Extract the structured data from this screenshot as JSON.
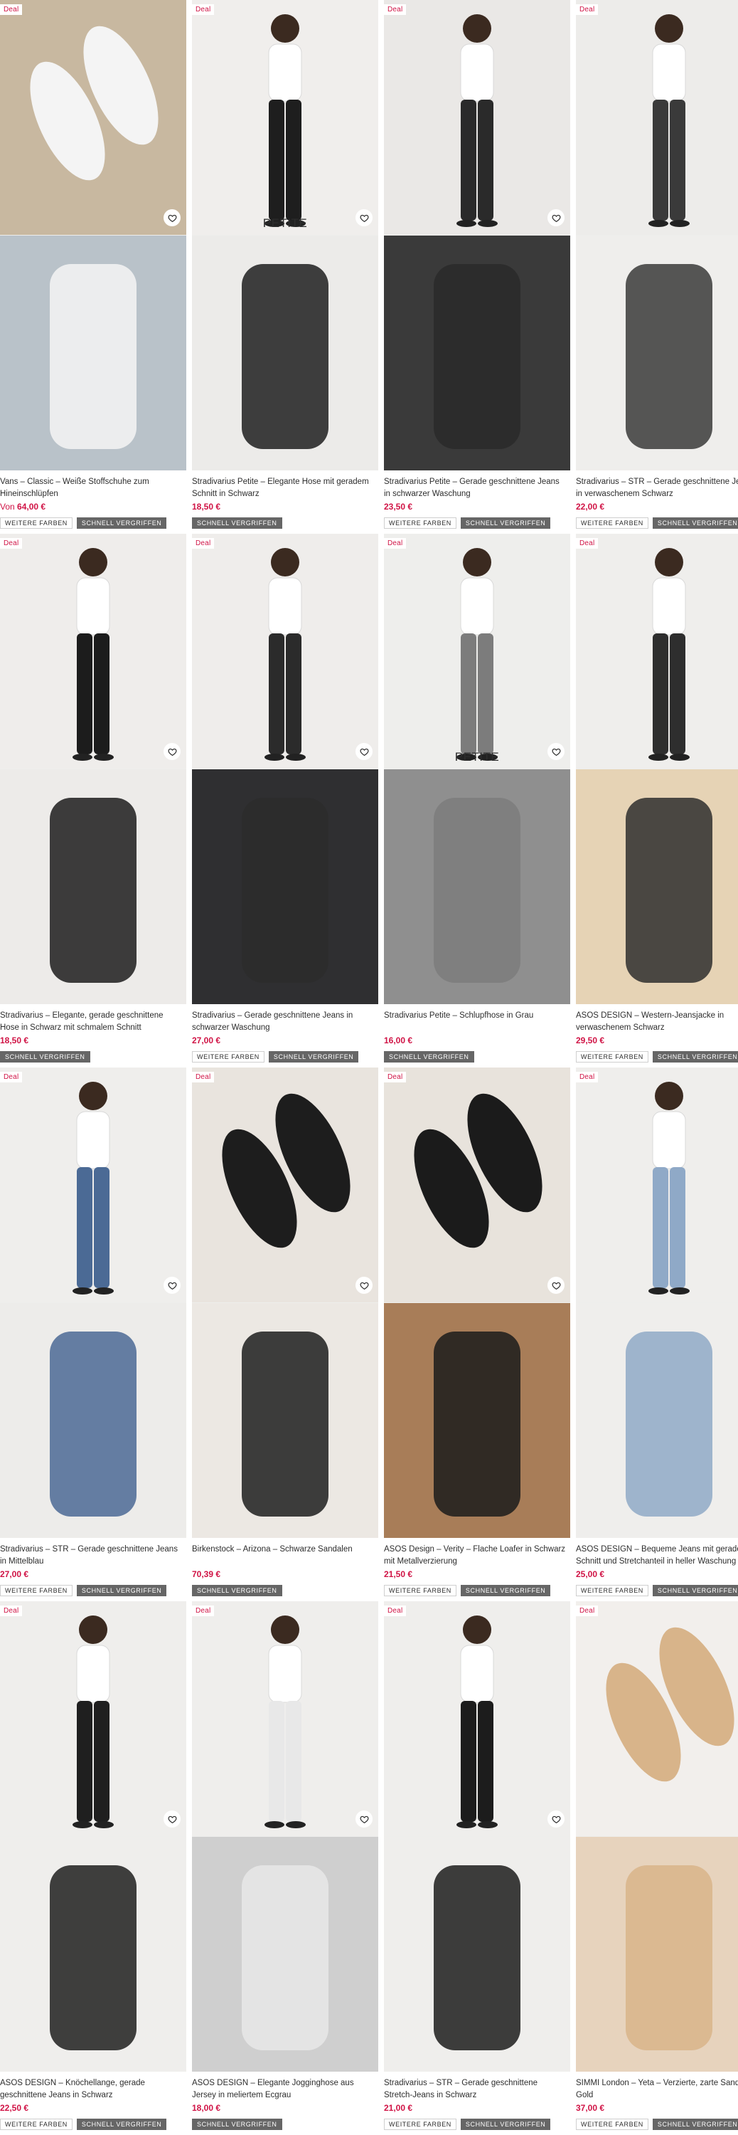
{
  "deal_label": "Deal",
  "badges": {
    "more_colors": "WEITERE FARBEN",
    "selling_fast": "SCHNELL VERGRIFFEN"
  },
  "products": [
    {
      "title": "Vans – Classic – Weiße Stoffschuhe zum Hineinschlüpfen",
      "price_prefix": "Von",
      "price": "64,00 €",
      "deal": true,
      "more_colors": true,
      "selling_fast": true,
      "petite": false,
      "img_a": "#c8b8a0",
      "img_b": "#b9c2c9"
    },
    {
      "title": "Stradivarius Petite – Elegante Hose mit geradem Schnitt in Schwarz",
      "price_prefix": "",
      "price": "18,50 €",
      "deal": true,
      "more_colors": false,
      "selling_fast": true,
      "petite": true,
      "img_a": "#f0eeec",
      "img_b": "#ecebe9"
    },
    {
      "title": "Stradivarius Petite – Gerade geschnittene Jeans in schwarzer Waschung",
      "price_prefix": "",
      "price": "23,50 €",
      "deal": true,
      "more_colors": true,
      "selling_fast": true,
      "petite": false,
      "img_a": "#eae8e6",
      "img_b": "#3a3a3a"
    },
    {
      "title": "Stradivarius – STR – Gerade geschnittene Jeans in verwaschenem Schwarz",
      "price_prefix": "",
      "price": "22,00 €",
      "deal": true,
      "more_colors": true,
      "selling_fast": true,
      "petite": false,
      "img_a": "#edecea",
      "img_b": "#efeeec"
    },
    {
      "title": "Stradivarius – Elegante, gerade geschnittene Hose in Schwarz mit schmalem Schnitt",
      "price_prefix": "",
      "price": "18,50 €",
      "deal": true,
      "more_colors": false,
      "selling_fast": true,
      "petite": false,
      "img_a": "#efedeb",
      "img_b": "#edebe9"
    },
    {
      "title": "Stradivarius – Gerade geschnittene Jeans in schwarzer Waschung",
      "price_prefix": "",
      "price": "27,00 €",
      "deal": true,
      "more_colors": true,
      "selling_fast": true,
      "petite": false,
      "img_a": "#efedeb",
      "img_b": "#2f2f31"
    },
    {
      "title": "Stradivarius Petite – Schlupfhose in Grau",
      "price_prefix": "",
      "price": "16,00 €",
      "deal": true,
      "more_colors": false,
      "selling_fast": true,
      "petite": true,
      "img_a": "#eeeeec",
      "img_b": "#8f8f8f"
    },
    {
      "title": "ASOS DESIGN – Western-Jeansjacke in verwaschenem Schwarz",
      "price_prefix": "",
      "price": "29,50 €",
      "deal": true,
      "more_colors": true,
      "selling_fast": true,
      "petite": false,
      "img_a": "#efeeec",
      "img_b": "#e6d3b5"
    },
    {
      "title": "Stradivarius – STR – Gerade geschnittene Jeans in Mittelblau",
      "price_prefix": "",
      "price": "27,00 €",
      "deal": true,
      "more_colors": true,
      "selling_fast": true,
      "petite": false,
      "img_a": "#efeeec",
      "img_b": "#edecea"
    },
    {
      "title": "Birkenstock – Arizona – Schwarze Sandalen",
      "price_prefix": "",
      "price": "70,39 €",
      "deal": true,
      "more_colors": false,
      "selling_fast": true,
      "petite": false,
      "img_a": "#e9e4de",
      "img_b": "#ece8e3"
    },
    {
      "title": "ASOS Design – Verity – Flache Loafer in Schwarz mit Metallverzierung",
      "price_prefix": "",
      "price": "21,50 €",
      "deal": true,
      "more_colors": true,
      "selling_fast": true,
      "petite": false,
      "img_a": "#e8e3dc",
      "img_b": "#a87d58"
    },
    {
      "title": "ASOS DESIGN – Bequeme Jeans mit geradem Schnitt und Stretchanteil in heller Waschung",
      "price_prefix": "",
      "price": "25,00 €",
      "deal": true,
      "more_colors": true,
      "selling_fast": true,
      "petite": false,
      "img_a": "#efeeec",
      "img_b": "#efeeec"
    },
    {
      "title": "ASOS DESIGN – Knöchellange, gerade geschnittene Jeans in Schwarz",
      "price_prefix": "",
      "price": "22,50 €",
      "deal": true,
      "more_colors": true,
      "selling_fast": true,
      "petite": false,
      "img_a": "#efeeec",
      "img_b": "#efeeec"
    },
    {
      "title": "ASOS DESIGN – Elegante Jogginghose aus Jersey in meliertem Ecgrau",
      "price_prefix": "",
      "price": "18,00 €",
      "deal": true,
      "more_colors": false,
      "selling_fast": true,
      "petite": false,
      "img_a": "#efeeec",
      "img_b": "#cfcfcf"
    },
    {
      "title": "Stradivarius – STR – Gerade geschnittene Stretch-Jeans in Schwarz",
      "price_prefix": "",
      "price": "21,00 €",
      "deal": true,
      "more_colors": true,
      "selling_fast": true,
      "petite": false,
      "img_a": "#efeeec",
      "img_b": "#efeeec"
    },
    {
      "title": "SIMMI London – Yeta – Verzierte, zarte Sandale in Gold",
      "price_prefix": "",
      "price": "37,00 €",
      "deal": true,
      "more_colors": true,
      "selling_fast": true,
      "petite": false,
      "img_a": "#f2efec",
      "img_b": "#e7d3bd"
    }
  ]
}
